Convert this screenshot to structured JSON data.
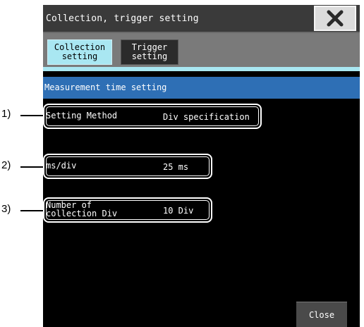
{
  "window": {
    "title": "Collection, trigger setting"
  },
  "tabs": [
    {
      "label": "Collection\nsetting",
      "active": true
    },
    {
      "label": "Trigger\nsetting",
      "active": false
    }
  ],
  "section": {
    "title": "Measurement time setting"
  },
  "fields": [
    {
      "label": "Setting Method",
      "value": "Div specification"
    },
    {
      "label": "ms/div",
      "value": "25 ms"
    },
    {
      "label": "Number of\ncollection Div",
      "value": "10 Div"
    }
  ],
  "footer": {
    "close_label": "Close"
  },
  "callouts": [
    "1)",
    "2)",
    "3)"
  ],
  "colors": {
    "tab_active": "#a9e7f2",
    "section_header": "#2e6fb5",
    "titlebar": "#3a3a3a",
    "screen_bg": "#000000"
  },
  "icons": {
    "close": "close-x-icon"
  }
}
